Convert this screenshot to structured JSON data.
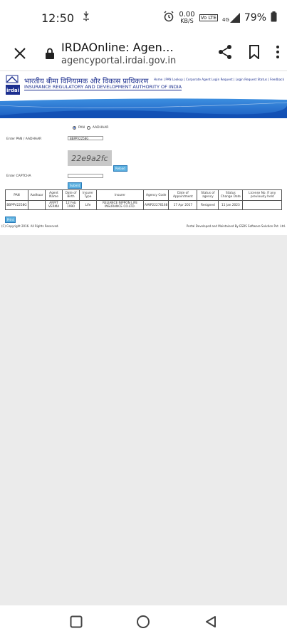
{
  "status_bar": {
    "time": "12:50",
    "net_speed": "0.00",
    "net_unit": "KB/S",
    "volte": "Vo LTE",
    "network": "4G",
    "battery": "79%"
  },
  "browser": {
    "page_title": "IRDAOnline: Agen…",
    "url": "agencyportal.irdai.gov.in"
  },
  "site": {
    "name_hindi": "भारतीय बीमा विनियामक और विकास प्राधिकरण",
    "name_english": "INSURANCE REGULATORY AND DEVELOPMENT AUTHORITY OF INDIA",
    "logo_text": "irdai",
    "top_nav": "Home | PAN Lookup | Corporate Agent Login Request | Login Request Status | Feedback"
  },
  "form": {
    "radio_pan": "PAN",
    "radio_aadhaar": "AADHAAR",
    "pan_label": "Enter PAN / AADHAAR",
    "pan_value": "BBPPV2258G",
    "captcha_text": "22e9a2fc",
    "reload_label": "Reload",
    "captcha_label": "Enter CAPTCHA",
    "captcha_value": "",
    "submit_label": "Submit"
  },
  "table": {
    "headers": [
      "PAN",
      "Aadhaar",
      "Agent Name",
      "Date of Birth",
      "Insurer Type",
      "Insurer",
      "Agency Code",
      "Date of Appointment",
      "Status of agency",
      "Status Change Date",
      "License No. If any previously held"
    ],
    "rows": [
      [
        "BBPPV2258G",
        "",
        "ARPIT VERMA",
        "12 Feb 1990",
        "Life",
        "RELIANCE NIPPON LIFE INSURANCE CO.LTD.",
        "AMIP22276168",
        "17 Apr 2017",
        "Resigned",
        "11 Jan 2023",
        ""
      ]
    ]
  },
  "print_label": "Print",
  "footer": {
    "copyright": "(C) Copyright 2016. All Rights Reserved.",
    "maintained": "Portal Developed and Maintained By ESDS Software Solution Pvt. Ltd."
  }
}
